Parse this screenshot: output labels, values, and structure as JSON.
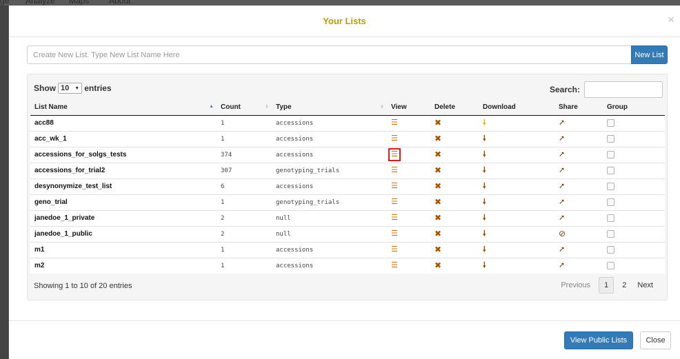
{
  "background_nav": {
    "items": [
      "ge",
      "Analyze",
      "Maps",
      "About"
    ]
  },
  "modal": {
    "title": "Your Lists",
    "close_symbol": "×",
    "new_list_placeholder": "Create New List. Type New List Name Here",
    "new_list_button": "New List",
    "show_label": "Show",
    "entries_label": "entries",
    "page_length": "10",
    "search_label": "Search:",
    "columns": [
      "List Name",
      "Count",
      "Type",
      "View",
      "Delete",
      "Download",
      "Share",
      "Group"
    ],
    "rows": [
      {
        "name": "acc88",
        "count": "1",
        "type": "accessions",
        "share": "share"
      },
      {
        "name": "acc_wk_1",
        "count": "1",
        "type": "accessions",
        "share": "share"
      },
      {
        "name": "accessions_for_solgs_tests",
        "count": "374",
        "type": "accessions",
        "share": "share"
      },
      {
        "name": "accessions_for_trial2",
        "count": "307",
        "type": "genotyping_trials",
        "share": "share"
      },
      {
        "name": "desynonymize_test_list",
        "count": "6",
        "type": "accessions",
        "share": "share"
      },
      {
        "name": "geno_trial",
        "count": "1",
        "type": "genotyping_trials",
        "share": "share"
      },
      {
        "name": "janedoe_1_private",
        "count": "2",
        "type": "null",
        "share": "share"
      },
      {
        "name": "janedoe_1_public",
        "count": "2",
        "type": "null",
        "share": "ban"
      },
      {
        "name": "m1",
        "count": "1",
        "type": "accessions",
        "share": "share"
      },
      {
        "name": "m2",
        "count": "1",
        "type": "accessions",
        "share": "share"
      }
    ],
    "info_text": "Showing 1 to 10 of 20 entries",
    "pagination": {
      "previous": "Previous",
      "pages": [
        "1",
        "2"
      ],
      "current": "1",
      "next": "Next"
    },
    "view_public_button": "View Public Lists",
    "close_button": "Close",
    "highlighted_row_index": 2,
    "colors": {
      "title": "#b8a000",
      "primary": "#337ab7",
      "icon_view": "#c57000",
      "highlight_box": "#e21a1a"
    },
    "icons": {
      "view": "list-icon",
      "delete": "times-icon",
      "download": "arrow-down-icon",
      "share": "share-arrow-icon",
      "ban": "ban-icon"
    }
  }
}
